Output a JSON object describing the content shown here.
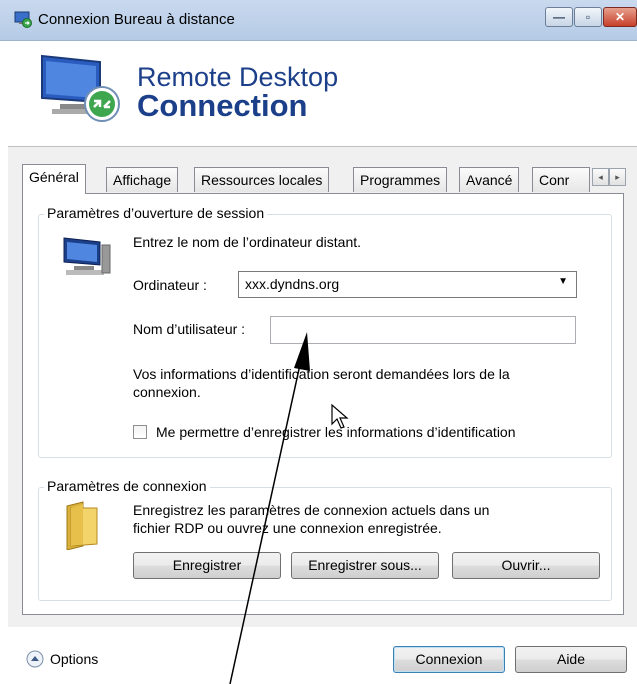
{
  "window": {
    "title": "Connexion Bureau à distance",
    "controls": {
      "minimize": "—",
      "maximize": "▫",
      "close": "✕"
    }
  },
  "banner": {
    "line1": "Remote Desktop",
    "line2": "Connection"
  },
  "tabs": [
    {
      "label": "Général",
      "active": true
    },
    {
      "label": "Affichage"
    },
    {
      "label": "Ressources locales"
    },
    {
      "label": "Programmes"
    },
    {
      "label": "Avancé"
    },
    {
      "label": "Conr"
    }
  ],
  "tab_scroll": {
    "left": "◂",
    "right": "▸"
  },
  "session_group": {
    "title": "Paramètres d’ouverture de session",
    "instruction": "Entrez le nom de l’ordinateur distant.",
    "computer_label": "Ordinateur :",
    "computer_value": "xxx.dyndns.org",
    "username_label": "Nom d’utilisateur :",
    "username_value": "",
    "info_line1": "Vos informations d’identification seront demandées lors de la",
    "info_line2": "connexion.",
    "remember_label": "Me permettre d’enregistrer les informations d’identification",
    "remember_checked": false
  },
  "connection_group": {
    "title": "Paramètres de connexion",
    "desc_line1": "Enregistrez les paramètres de connexion actuels dans un",
    "desc_line2": "fichier RDP ou ouvrez une connexion enregistrée.",
    "save_button": "Enregistrer",
    "save_as_button": "Enregistrer sous...",
    "open_button": "Ouvrir..."
  },
  "footer": {
    "options_label": "Options",
    "connect_button": "Connexion",
    "help_button": "Aide"
  },
  "colors": {
    "brand": "#1c3f8a",
    "titlebar": "#c9d9ee",
    "close": "#c7402a"
  }
}
